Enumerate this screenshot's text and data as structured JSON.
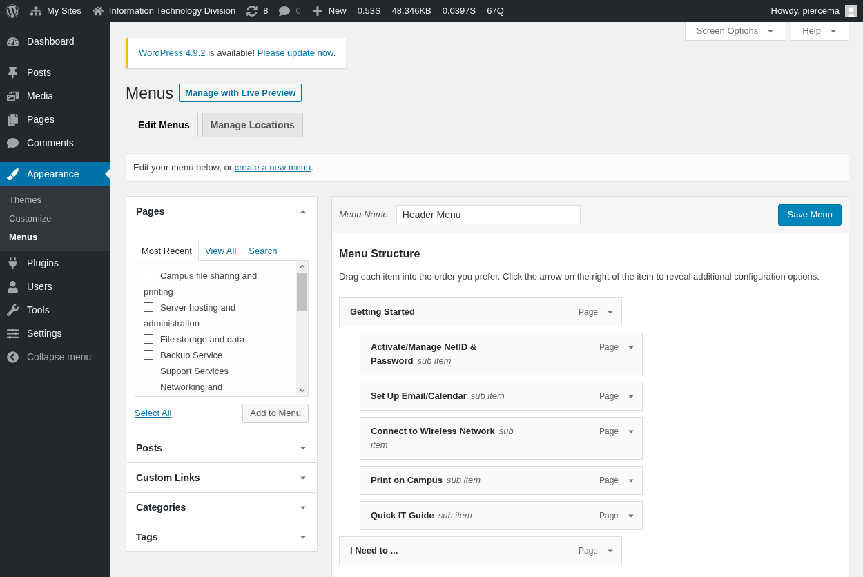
{
  "admin_bar": {
    "items": [
      {
        "label": "My Sites"
      },
      {
        "label": "Information Technology Division"
      },
      {
        "label": "8"
      },
      {
        "label": "0"
      },
      {
        "label": "New"
      },
      {
        "label": "0.53S"
      },
      {
        "label": "48,346KB"
      },
      {
        "label": "0.0397S"
      },
      {
        "label": "67Q"
      }
    ],
    "greeting": "Howdy, piercema"
  },
  "sidebar": {
    "items": [
      {
        "label": "Dashboard",
        "selected": false
      },
      {
        "label": "Posts",
        "selected": false
      },
      {
        "label": "Media",
        "selected": false
      },
      {
        "label": "Pages",
        "selected": false
      },
      {
        "label": "Comments",
        "selected": false
      },
      {
        "label": "Appearance",
        "selected": true,
        "children": [
          {
            "label": "Themes",
            "selected": false
          },
          {
            "label": "Customize",
            "selected": false
          },
          {
            "label": "Menus",
            "selected": true
          }
        ]
      },
      {
        "label": "Plugins",
        "selected": false
      },
      {
        "label": "Users",
        "selected": false
      },
      {
        "label": "Tools",
        "selected": false
      },
      {
        "label": "Settings",
        "selected": false
      },
      {
        "label": "Collapse menu",
        "selected": false
      }
    ]
  },
  "screen_meta": [
    "Screen Options",
    "Help"
  ],
  "notice": [
    {
      "kind": "link",
      "text": "WordPress 4.9.2"
    },
    {
      "kind": "text",
      "text": " is available! "
    },
    {
      "kind": "link",
      "text": "Please update now"
    },
    {
      "kind": "text",
      "text": "."
    }
  ],
  "title": "Menus",
  "title_button": "Manage with Live Preview",
  "tabs": [
    {
      "label": "Edit Menus",
      "selected": true
    },
    {
      "label": "Manage Locations",
      "selected": false
    }
  ],
  "intro": [
    {
      "kind": "text",
      "text": "Edit your menu below, or "
    },
    {
      "kind": "link",
      "text": "create a new menu"
    },
    {
      "kind": "text",
      "text": "."
    }
  ],
  "sections": [
    {
      "title": "Pages",
      "expanded": true,
      "tabs": [
        {
          "label": "Most Recent",
          "selected": true
        },
        {
          "label": "View All",
          "selected": false
        },
        {
          "label": "Search",
          "selected": false
        }
      ],
      "items": [
        {
          "label": "Campus file sharing and printing",
          "checked": false
        },
        {
          "label": "Server hosting and administration",
          "checked": false
        },
        {
          "label": "File storage and data",
          "checked": false
        },
        {
          "label": "Backup Service",
          "checked": false
        },
        {
          "label": "Support Services",
          "checked": false
        },
        {
          "label": "Networking and",
          "checked": false
        }
      ],
      "select_all": "Select All",
      "add_button": "Add to Menu"
    },
    {
      "title": "Posts",
      "expanded": false
    },
    {
      "title": "Custom Links",
      "expanded": false
    },
    {
      "title": "Categories",
      "expanded": false
    },
    {
      "title": "Tags",
      "expanded": false
    }
  ],
  "menu_name": {
    "label": "Menu Name",
    "value": "Header Menu"
  },
  "save_button": "Save Menu",
  "structure": {
    "heading": "Menu Structure",
    "description": "Drag each item into the order you prefer. Click the arrow on the right of the item to reveal additional configuration options.",
    "items": [
      {
        "title": "Getting Started",
        "type": "Page",
        "children": [
          {
            "title": "Activate/Manage NetID & Password",
            "note": "sub item",
            "type": "Page"
          },
          {
            "title": "Set Up Email/Calendar",
            "note": "sub item",
            "type": "Page"
          },
          {
            "title": "Connect to Wireless Network",
            "note": "sub item",
            "type": "Page"
          },
          {
            "title": "Print on Campus",
            "note": "sub item",
            "type": "Page"
          },
          {
            "title": "Quick IT Guide",
            "note": "sub item",
            "type": "Page"
          }
        ]
      },
      {
        "title": "I Need to ...",
        "type": "Page"
      }
    ]
  }
}
